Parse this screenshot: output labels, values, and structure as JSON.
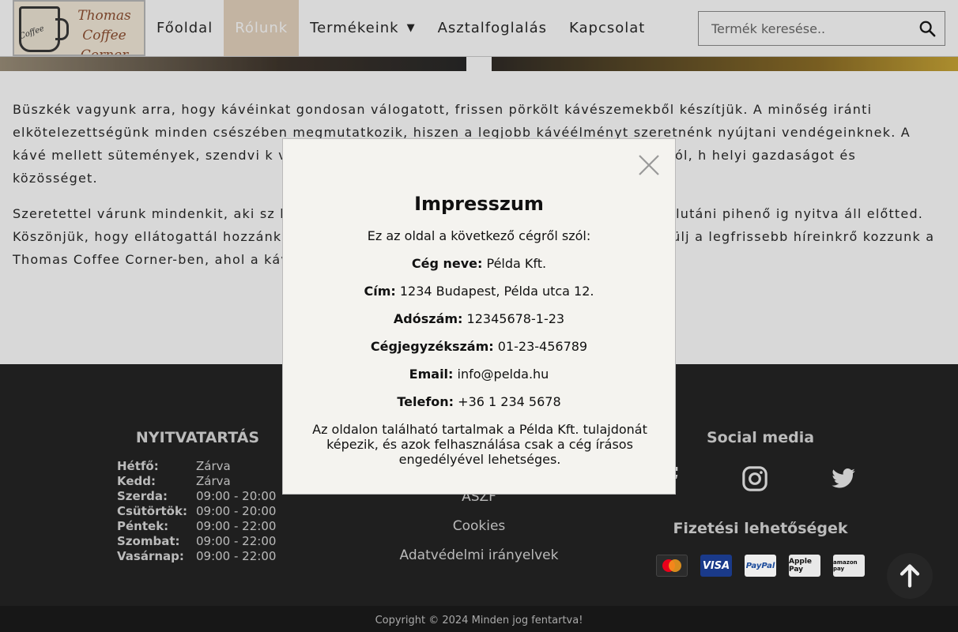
{
  "header": {
    "logo_text": "Thomas Coffee Corner",
    "logo_cup_text": "Coffee",
    "nav": [
      {
        "label": "Főoldal"
      },
      {
        "label": "Rólunk"
      },
      {
        "label": "Termékeink"
      },
      {
        "label": "Asztalfoglalás"
      },
      {
        "label": "Kapcsolat"
      }
    ],
    "active_nav": "Rólunk",
    "search_placeholder": "Termék keresése.."
  },
  "content": {
    "paragraphs": [
      "Büszkék vagyunk arra, hogy kávéinkat gondosan válogatott, frissen pörkölt kávészemekből készítjük. A minőség iránti elkötelezettségünk minden csészében megmutatkozik, hiszen a legjobb kávéélményt szeretnénk nyújtani vendégeinknek. A kávé mellett sütemények, szendvi                                                                   k vendégeinket. Minden termékünket friss alapanyagokból, h                                                               helyi gazdaságot és közösséget.",
      "Szeretettel várunk mindenkit, aki sz                                                               kávé társaságában. Legyen szó reggeli ébresztőről, délutáni pihenő                                                             ig nyitva áll előtted. Köszönjük, hogy ellátogattál hozzánk, és remél                                                         s minket a közösségi médiában, hogy értesülj a legfrissebb híreinkrő                                                         kozzunk a Thomas Coffee Corner-ben, ahol a kávé és a közösség talál"
    ]
  },
  "footer": {
    "hours_title": "NYITVATARTÁS",
    "hours": [
      {
        "day": "Hétfő:",
        "time": "Zárva"
      },
      {
        "day": "Kedd:",
        "time": "Zárva"
      },
      {
        "day": "Szerda:",
        "time": "09:00 - 20:00"
      },
      {
        "day": "Csütörtök:",
        "time": "09:00 - 20:00"
      },
      {
        "day": "Péntek:",
        "time": "09:00 - 22:00"
      },
      {
        "day": "Szombat:",
        "time": "09:00 - 22:00"
      },
      {
        "day": "Vasárnap:",
        "time": "09:00 - 22:00"
      }
    ],
    "links": [
      "ÁSZF",
      "Cookies",
      "Adatvédelmi irányelvek"
    ],
    "social_title": "Social media",
    "payment_title": "Fizetési lehetőségek",
    "payments": [
      "MasterCard",
      "VISA",
      "PayPal",
      "Apple Pay",
      "amazon pay"
    ],
    "copyright": "Copyright © 2024 Minden jog fentartva!"
  },
  "modal": {
    "title": "Impresszum",
    "intro": "Ez az oldal a következő cégről szól:",
    "fields": [
      {
        "label": "Cég neve:",
        "value": "Példa Kft."
      },
      {
        "label": "Cím:",
        "value": "1234 Budapest, Példa utca 12."
      },
      {
        "label": "Adószám:",
        "value": "12345678-1-23"
      },
      {
        "label": "Cégjegyzékszám:",
        "value": "01-23-456789"
      },
      {
        "label": "Email:",
        "value": "info@pelda.hu"
      },
      {
        "label": "Telefon:",
        "value": "+36 1 234 5678"
      }
    ],
    "note": "Az oldalon található tartalmak a Példa Kft. tulajdonát képezik, és azok felhasználása csak a cég írásos engedélyével lehetséges."
  },
  "colors": {
    "active_nav_bg": "#e6d3be",
    "footer_bg": "#1f1f1f",
    "modal_bg": "#f4f3ef",
    "logo_accent": "#8b4a2b"
  },
  "icons": [
    "search-icon",
    "chevron-down-icon",
    "close-icon",
    "facebook-icon",
    "instagram-icon",
    "twitter-icon",
    "arrow-up-icon"
  ]
}
